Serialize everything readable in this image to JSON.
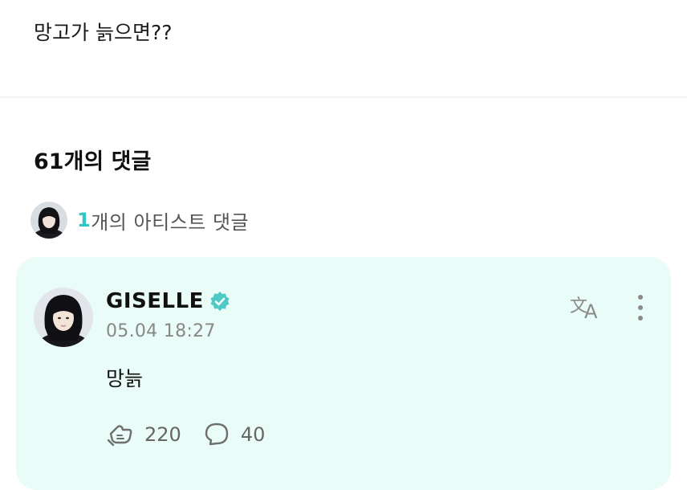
{
  "post": {
    "text": "망고가 늙으면??"
  },
  "comments": {
    "count_label": "61개의 댓글"
  },
  "artist_comments": {
    "count": "1",
    "label": "개의 아티스트 댓글"
  },
  "comment": {
    "author": "GISELLE",
    "timestamp": "05.04 18:27",
    "body": "망늙",
    "likes": "220",
    "replies": "40"
  },
  "colors": {
    "accent": "#2ec7c4",
    "card_bg": "#e9fcf8",
    "verified": "#4ec9c6"
  },
  "icons": {
    "verified": "verified-badge-icon",
    "translate": "translate-icon",
    "more": "more-vertical-icon",
    "like": "like-icon",
    "reply": "reply-icon"
  }
}
